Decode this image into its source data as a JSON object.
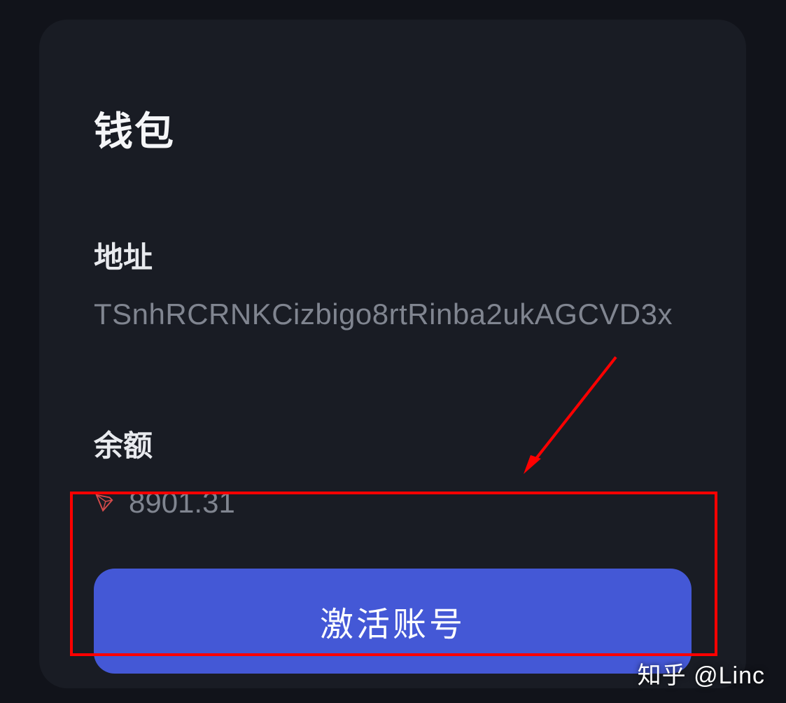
{
  "wallet": {
    "title": "钱包",
    "address_label": "地址",
    "address_value": "TSnhRCRNKCizbigo8rtRinba2ukAGCVD3x",
    "balance_label": "余额",
    "balance_value": "8901.31",
    "activate_button_label": "激活账号"
  },
  "watermark": "知乎 @Linc",
  "colors": {
    "background": "#11131a",
    "card_bg": "#191c24",
    "text_primary": "#f5f6f8",
    "text_secondary": "#808590",
    "button_bg": "#4458d6",
    "highlight": "#ff0000"
  }
}
